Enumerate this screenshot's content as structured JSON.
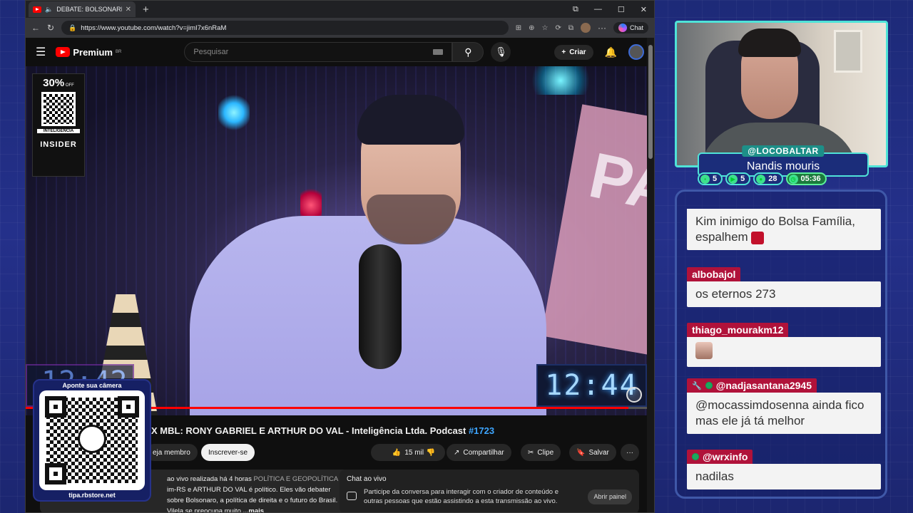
{
  "browser": {
    "tab_title": "DEBATE: BOLSONARISTA X MBL",
    "url": "https://www.youtube.com/watch?v=jimI7x6nRaM",
    "chat_label": "Chat"
  },
  "youtube": {
    "logo_text": "Premium",
    "region": "BR",
    "search_placeholder": "Pesquisar",
    "create_label": "Criar"
  },
  "video": {
    "promo_percent": "30%",
    "promo_off": "OFF",
    "promo_tag": "INTELIGÊNCIA",
    "promo_brand": "INSIDER",
    "clock_right": "12:44",
    "clock_left": "12:42",
    "progress_fraction": 0.97
  },
  "title": {
    "text": "X MBL: RONY GABRIEL E ARTHUR DO VAL - Inteligência Ltda. Podcast",
    "hashtag": "#1723"
  },
  "actions": {
    "member_label": "eja membro",
    "subscribe_label": "Inscrever-se",
    "likes": "15 mil",
    "share_label": "Compartilhar",
    "clip_label": "Clipe",
    "save_label": "Salvar"
  },
  "description": {
    "line1": "ao vivo realizada há 4 horas",
    "category": "POLÍTICA E GEOPOLÍTICA",
    "line2": "im-RS e ARTHUR DO VAL é político. Eles vão debater",
    "line3": "sobre Bolsonaro, a política de direita e o futuro do Brasil. O Vilela se preocupa muito",
    "more": "...mais"
  },
  "livechat": {
    "title": "Chat ao vivo",
    "body": "Participe da conversa para interagir com o criador de conteúdo e outras pessoas que estão assistindo a esta transmissão ao vivo.",
    "open_label": "Abrir painel"
  },
  "qr": {
    "caption": "Aponte sua câmera",
    "url": "tipa.rbstore.net"
  },
  "streamer": {
    "handle": "@LOCOBALTAR",
    "name": "Nandis mouris",
    "stats": [
      {
        "icon": "chat-icon",
        "value": "5"
      },
      {
        "icon": "youtube-icon",
        "value": "5"
      },
      {
        "icon": "viewers-icon",
        "value": "28"
      },
      {
        "icon": "timer-icon",
        "value": "05:36"
      }
    ]
  },
  "chat": {
    "messages": [
      {
        "user": "",
        "text": "Kim inimigo do Bolsa Família, espalhem"
      },
      {
        "user": "albobajol",
        "text": "os eternos 273"
      },
      {
        "user": "thiago_mourakm12",
        "text": ""
      },
      {
        "user": "@nadjasantana2945",
        "text": "@mocassimdosenna ainda fico mas ele já tá melhor"
      },
      {
        "user": "@wrxinfo",
        "text": "nadilas"
      }
    ]
  },
  "colors": {
    "accent_teal": "#4fe3d8",
    "chat_user_bg": "#b0123a",
    "yt_red": "#ff0000"
  }
}
